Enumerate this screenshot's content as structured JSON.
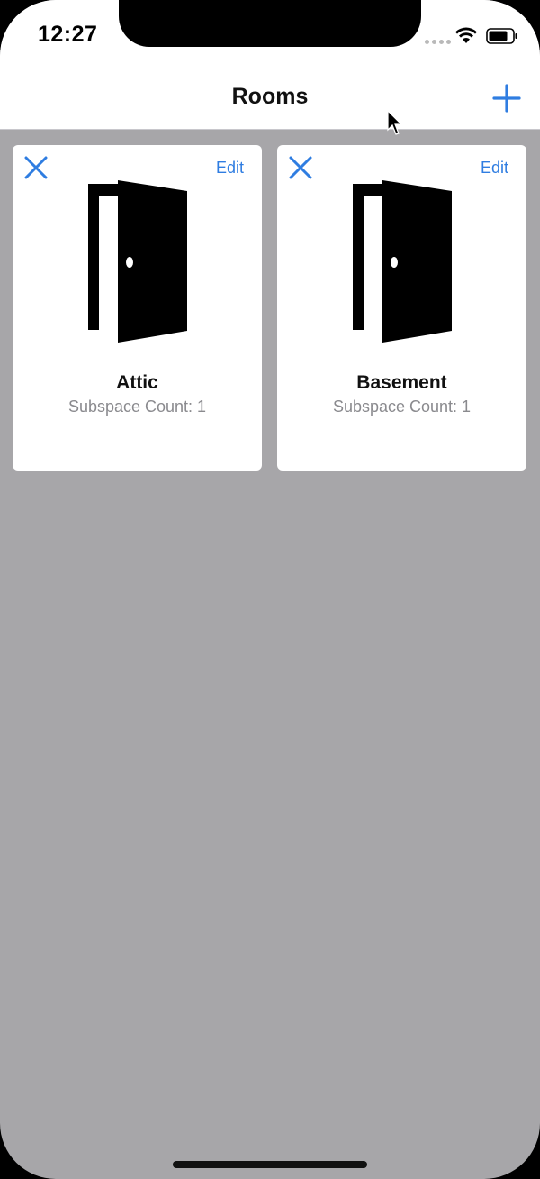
{
  "status_bar": {
    "time": "12:27",
    "icons": [
      "signal-icon",
      "wifi-icon",
      "battery-icon"
    ]
  },
  "nav": {
    "title": "Rooms",
    "add_icon": "plus-icon"
  },
  "rooms": [
    {
      "name": "Attic",
      "subtitle": "Subspace Count: 1",
      "edit_label": "Edit",
      "icon": "door-icon"
    },
    {
      "name": "Basement",
      "subtitle": "Subspace Count: 1",
      "edit_label": "Edit",
      "icon": "door-icon"
    }
  ],
  "colors": {
    "accent": "#2f7de1",
    "background": "#a7a6a9",
    "card": "#ffffff",
    "subtitle": "#8a8a8e"
  }
}
